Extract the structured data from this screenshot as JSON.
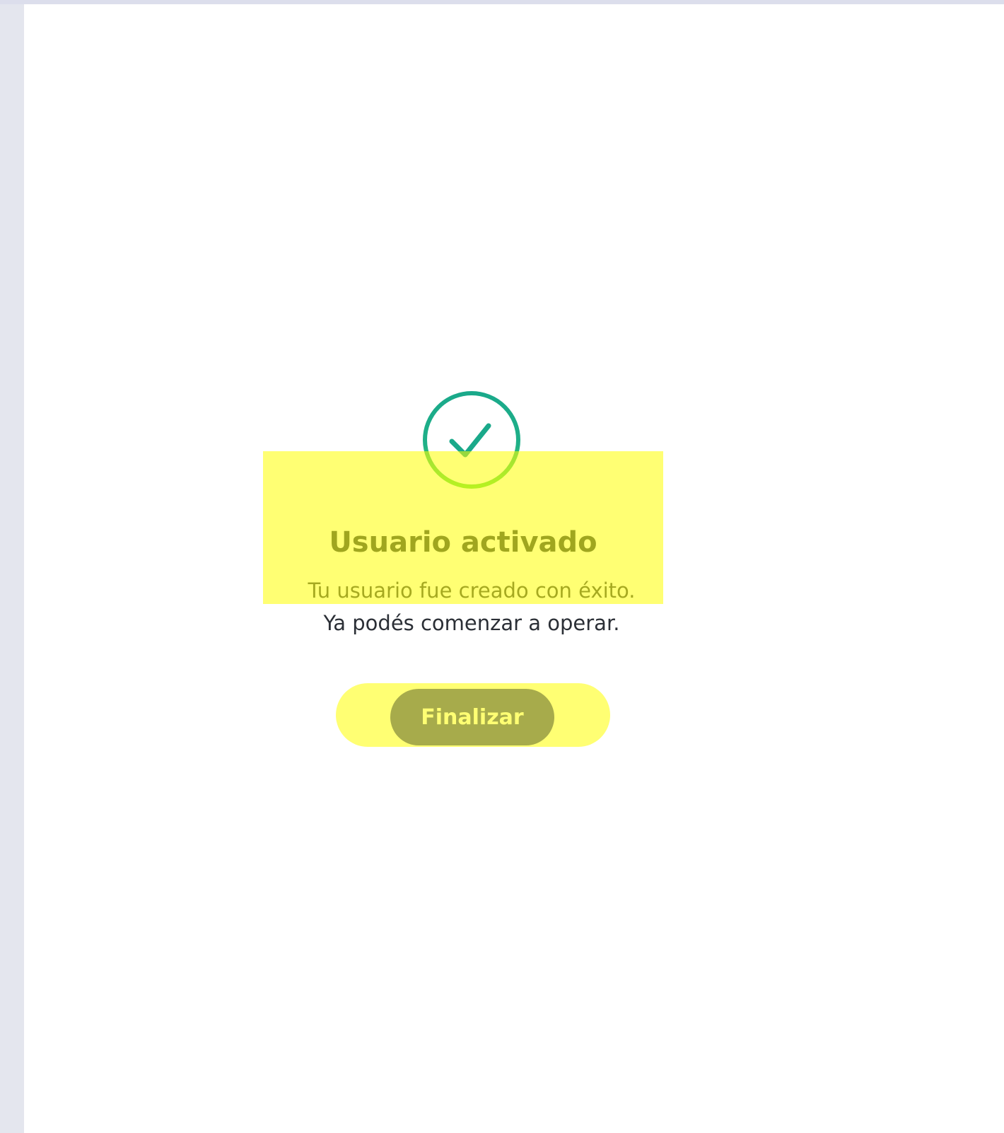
{
  "success": {
    "icon": "check-circle-icon",
    "title": "Usuario activado",
    "message_line1": "Tu usuario fue creado con éxito.",
    "message_line2": "Ya podés comenzar a operar.",
    "button_label": "Finalizar"
  },
  "colors": {
    "check_gradient_start": "#1aa98a",
    "check_gradient_end": "#5fe04a",
    "button_bg": "#3c46a6",
    "highlight": "#ffff00"
  }
}
